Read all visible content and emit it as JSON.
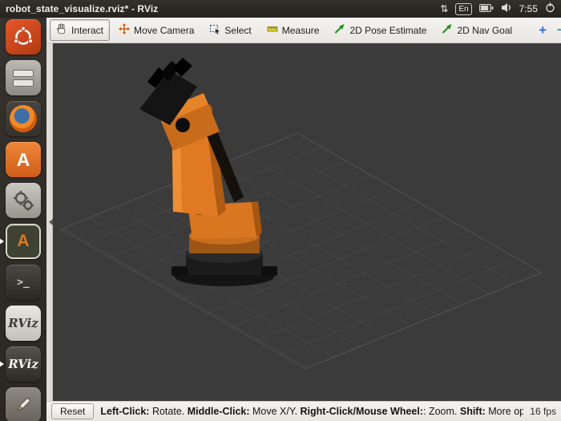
{
  "topbar": {
    "title": "robot_state_visualize.rviz* - RViz",
    "keyboard_indicator": "⇅",
    "language": "En",
    "time": "7:55"
  },
  "launcher": {
    "items": [
      {
        "name": "ubuntu-dash"
      },
      {
        "name": "files"
      },
      {
        "name": "firefox"
      },
      {
        "name": "software-center",
        "glyph": "A"
      },
      {
        "name": "system-settings"
      },
      {
        "name": "software-updater",
        "glyph": "A",
        "focused": true
      },
      {
        "name": "terminal",
        "glyph": ">_"
      },
      {
        "name": "rviz-light",
        "label": "RViz"
      },
      {
        "name": "rviz-dark",
        "label": "RViz",
        "running": true
      },
      {
        "name": "text-editor"
      }
    ]
  },
  "toolbar": {
    "tools": [
      {
        "label": "Interact",
        "active": true
      },
      {
        "label": "Move Camera"
      },
      {
        "label": "Select"
      },
      {
        "label": "Measure"
      },
      {
        "label": "2D Pose Estimate"
      },
      {
        "label": "2D Nav Goal"
      }
    ],
    "add_label": "+",
    "collapse_label": "−",
    "caret": "▾"
  },
  "statusbar": {
    "reset_label": "Reset",
    "k1": "Left-Click:",
    "v1": " Rotate.  ",
    "k2": "Middle-Click:",
    "v2": " Move X/Y.  ",
    "k3": "Right-Click/Mouse Wheel:",
    "v3": ": Zoom.  ",
    "k4": "Shift:",
    "v4": " More opt",
    "fps": "16 fps"
  },
  "colors": {
    "robot_orange": "#e07a22",
    "viewport_bg": "#3b3b3b",
    "grid_line": "#505050",
    "topbar_bg": "#2c2823",
    "tool_arrow_green": "#1f8f1f",
    "add_plus_blue": "#2f6fe0"
  }
}
